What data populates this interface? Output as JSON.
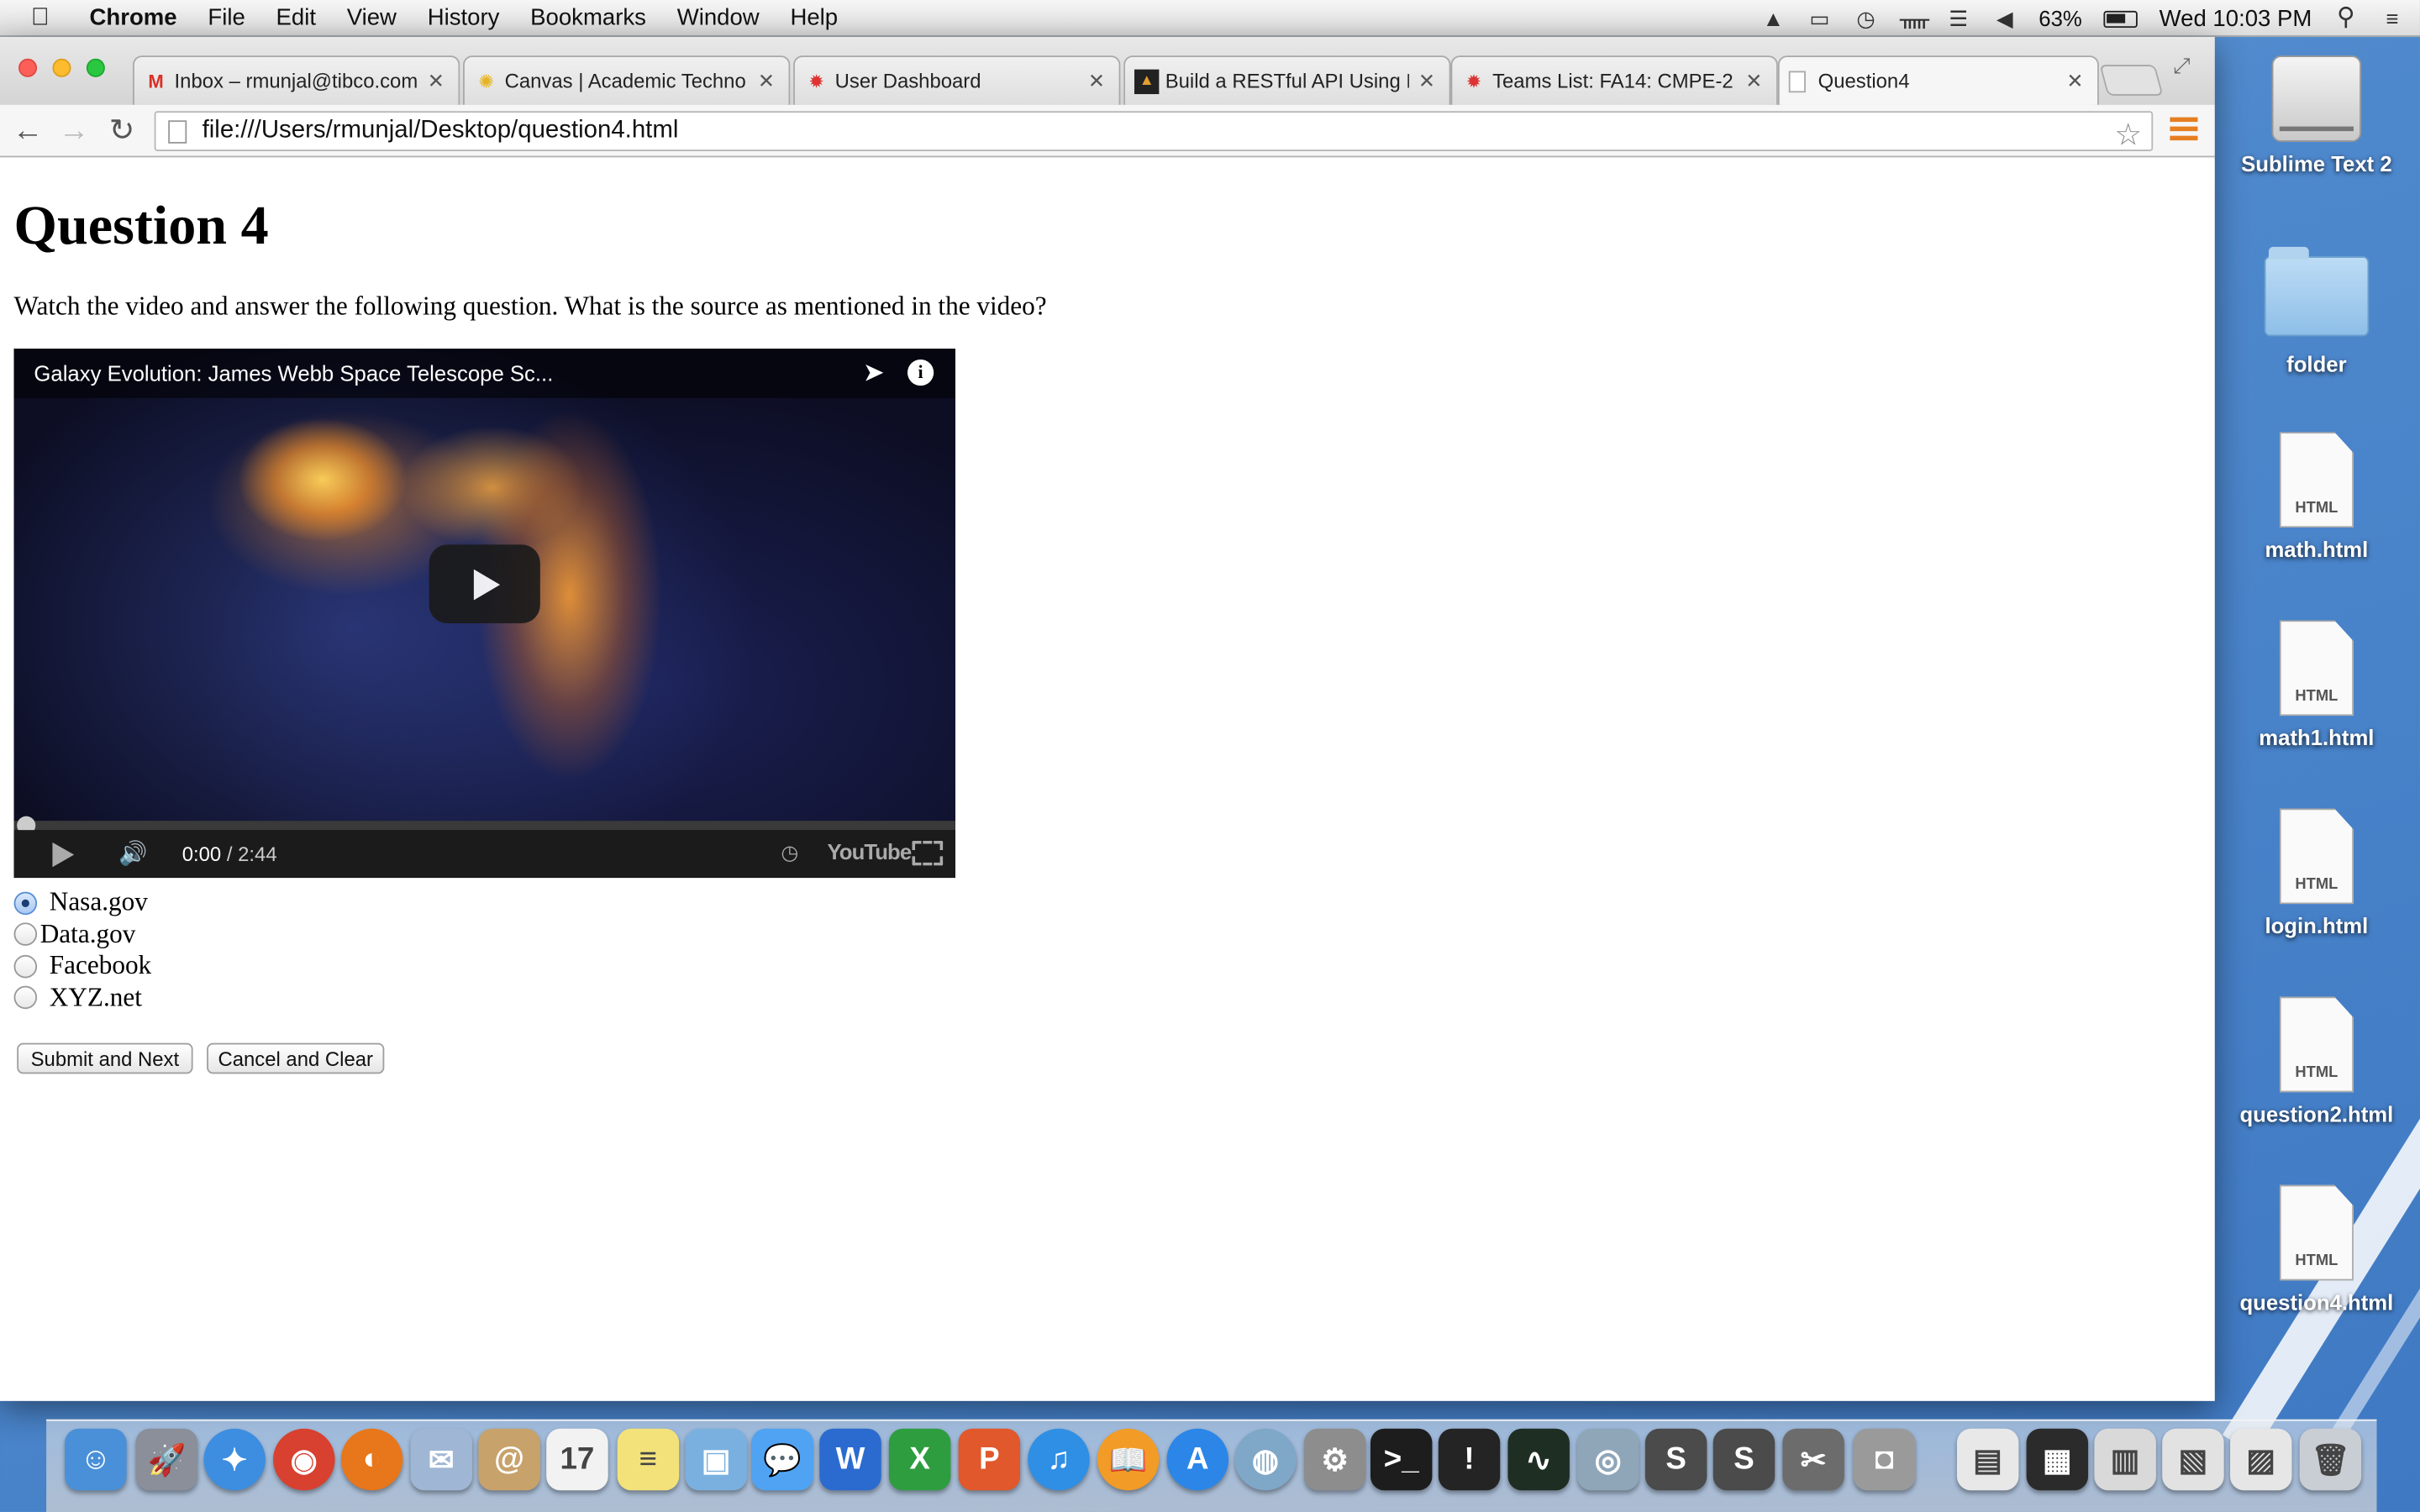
{
  "menubar": {
    "app_name": "Chrome",
    "items": [
      "File",
      "Edit",
      "View",
      "History",
      "Bookmarks",
      "Window",
      "Help"
    ],
    "battery": "63%",
    "clock": "Wed 10:03 PM"
  },
  "tabs": [
    {
      "title": "Inbox – rmunjal@tibco.com",
      "icon": "gmail-icon"
    },
    {
      "title": "Canvas | Academic Techno",
      "icon": "canvas-icon"
    },
    {
      "title": "User Dashboard",
      "icon": "sjsu-icon"
    },
    {
      "title": "Build a RESTful API Using N",
      "icon": "scotch-icon"
    },
    {
      "title": "Teams List: FA14: CMPE-2",
      "icon": "sjsu-icon"
    },
    {
      "title": "Question4",
      "icon": "page-icon"
    }
  ],
  "address_bar": {
    "url": "file:///Users/rmunjal/Desktop/question4.html"
  },
  "page": {
    "heading": "Question 4",
    "prompt": "Watch the video and answer the following question. What is the source as mentioned in the video?",
    "video": {
      "title": "Galaxy Evolution: James Webb Space Telescope Sc...",
      "time_current": "0:00",
      "time_total": " / 2:44",
      "brand": "YouTube",
      "progress": 0
    },
    "options": [
      {
        "label": "Nasa.gov",
        "checked": true
      },
      {
        "label": "Data.gov",
        "checked": false
      },
      {
        "label": "Facebook",
        "checked": false
      },
      {
        "label": "XYZ.net",
        "checked": false
      }
    ],
    "submit_label": "Submit and Next",
    "cancel_label": "Cancel and Clear"
  },
  "desktop_icons": [
    {
      "label": "Sublime Text 2",
      "type": "drive"
    },
    {
      "label": "folder",
      "type": "folder"
    },
    {
      "label": "math.html",
      "type": "html",
      "tag": "HTML"
    },
    {
      "label": "math1.html",
      "type": "html",
      "tag": "HTML"
    },
    {
      "label": "login.html",
      "type": "html",
      "tag": "HTML"
    },
    {
      "label": "question2.html",
      "type": "html",
      "tag": "HTML"
    },
    {
      "label": "question4.html",
      "type": "html",
      "tag": "HTML"
    }
  ],
  "dock": [
    {
      "name": "finder-icon",
      "color": "#4a90d9",
      "glyph": "☺"
    },
    {
      "name": "launchpad-icon",
      "color": "#8a8f99",
      "glyph": "🚀"
    },
    {
      "name": "safari-icon",
      "color": "#3d8ee0",
      "glyph": "✦"
    },
    {
      "name": "chrome-icon",
      "color": "#d8402f",
      "glyph": "◉"
    },
    {
      "name": "firefox-icon",
      "color": "#e8761a",
      "glyph": "◐"
    },
    {
      "name": "mail-icon",
      "color": "#9fb7d4",
      "glyph": "✉"
    },
    {
      "name": "contacts-icon",
      "color": "#c8a26b",
      "glyph": "@"
    },
    {
      "name": "calendar-icon",
      "color": "#f2f2f2",
      "glyph": "17"
    },
    {
      "name": "notes-icon",
      "color": "#f3e27a",
      "glyph": "≡"
    },
    {
      "name": "preview-icon",
      "color": "#7ab0e0",
      "glyph": "▣"
    },
    {
      "name": "messages-icon",
      "color": "#4fa3f2",
      "glyph": "💬"
    },
    {
      "name": "word-icon",
      "color": "#2b6bd0",
      "glyph": "W"
    },
    {
      "name": "excel-icon",
      "color": "#2e9d3f",
      "glyph": "X"
    },
    {
      "name": "powerpoint-icon",
      "color": "#e0582b",
      "glyph": "P"
    },
    {
      "name": "itunes-icon",
      "color": "#2f8fe5",
      "glyph": "♫"
    },
    {
      "name": "ibooks-icon",
      "color": "#f29b26",
      "glyph": "📖"
    },
    {
      "name": "appstore-icon",
      "color": "#2b86e8",
      "glyph": "A"
    },
    {
      "name": "network-icon",
      "color": "#7fa7c7",
      "glyph": "◍"
    },
    {
      "name": "system-preferences-icon",
      "color": "#8d8d8d",
      "glyph": "⚙"
    },
    {
      "name": "terminal-icon",
      "color": "#1d1d1d",
      "glyph": ">_"
    },
    {
      "name": "console-icon",
      "color": "#242424",
      "glyph": "!"
    },
    {
      "name": "activity-monitor-icon",
      "color": "#1f2e23",
      "glyph": "∿"
    },
    {
      "name": "photo-icon",
      "color": "#8fa6b9",
      "glyph": "◎"
    },
    {
      "name": "sublime-icon",
      "color": "#4b4b4b",
      "glyph": "S"
    },
    {
      "name": "sublime2-icon",
      "color": "#4b4b4b",
      "glyph": "S"
    },
    {
      "name": "utilities-icon",
      "color": "#6c6c6c",
      "glyph": "✂"
    },
    {
      "name": "screenshot-icon",
      "color": "#9a9a9a",
      "glyph": "◘"
    },
    {
      "name": "documents-stack-icon",
      "color": "#e8e8e8",
      "glyph": "▤"
    },
    {
      "name": "downloads-stack-icon",
      "color": "#2b2b2b",
      "glyph": "▦"
    },
    {
      "name": "window-stack-icon",
      "color": "#d9d9d9",
      "glyph": "▥"
    },
    {
      "name": "window-stack2-icon",
      "color": "#e2e2e2",
      "glyph": "▧"
    },
    {
      "name": "window-stack3-icon",
      "color": "#e6e6e6",
      "glyph": "▨"
    },
    {
      "name": "trash-icon",
      "color": "#c9ced4",
      "glyph": "🗑"
    }
  ]
}
